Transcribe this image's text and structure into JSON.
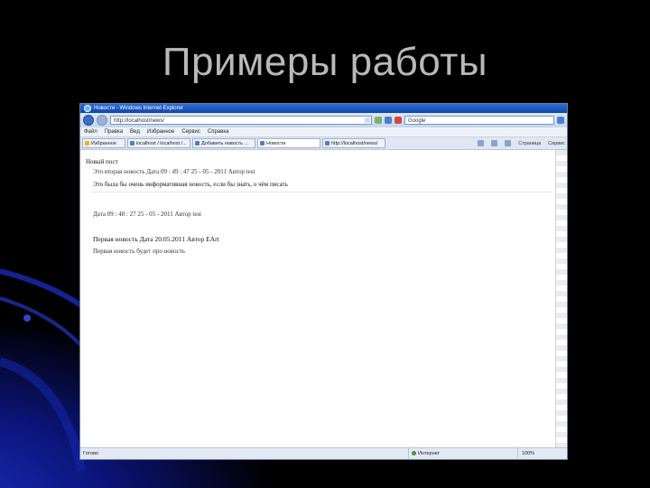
{
  "slide": {
    "title": "Примеры работы"
  },
  "browser": {
    "window_title": "Новости - Windows Internet Explorer",
    "address": "http://localhost/news/",
    "search_placeholder": "Google",
    "menu": [
      "Файл",
      "Правка",
      "Вид",
      "Избранное",
      "Сервис",
      "Справка"
    ],
    "favorites_label": "Избранное",
    "tabs": [
      {
        "label": "localhost / localhost /..."
      },
      {
        "label": "Добавить новость ..."
      },
      {
        "label": "Новости"
      },
      {
        "label": "http://localhost/news/"
      }
    ],
    "tab_tools": [
      "Страница",
      "Сервис"
    ],
    "status": {
      "left": "Готово",
      "zone": "Интернет",
      "zoom": "100%"
    }
  },
  "page": {
    "add_link": "Новый пост",
    "news": [
      {
        "meta": "Это вторая новость Дата 09 : 49 : 47 25 - 05 - 2011 Автор test",
        "body": "Это была бы очень информативная новость, если бы знать, о чём писать"
      },
      {
        "meta": "Дата 09 : 48 : 27 25 - 05 - 2011 Автор test",
        "body": ""
      },
      {
        "meta": "Первая новость Дата 20.05.2011 Автор EArt",
        "body": "Первая новость будет про новость"
      }
    ]
  },
  "colors": {
    "title_text": "#b9b9b9",
    "background": "#000000",
    "accent_blue": "#1a2dbf"
  }
}
